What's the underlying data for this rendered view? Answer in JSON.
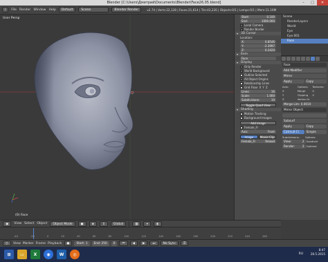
{
  "window": {
    "title": "Blender  [C:\\Users\\Дмитрий\\Documents\\Blender\\Face26.05.blend]",
    "minimize": "–",
    "maximize": "□",
    "close": "✕"
  },
  "info_header": {
    "menus": [
      "File",
      "Render",
      "Window",
      "Help"
    ],
    "layout": "Default",
    "scene": "Scene",
    "engine": "Blender Render",
    "stats": "v2.74 | Verts:22,128 | Faces:21,614 | Tris:43,226 | Objects:0/1 | Lamps:0/1 | Mem:11.16M"
  },
  "viewport": {
    "view_label": "User Persp",
    "object_label": "(0) Face"
  },
  "n_panel": {
    "clip": {
      "header": "Clip",
      "start_label": "Start:",
      "start_value": "0.100",
      "end_label": "End:",
      "end_value": "1000.000",
      "local_camera": "Local Camera",
      "render_border": "Render Border"
    },
    "cursor": {
      "header": "3D Cursor",
      "location": "Location:",
      "x_label": "X:",
      "x": "0.8546",
      "y_label": "Y:",
      "y": "-2.3997",
      "z_label": "Z:",
      "z": "0.2420"
    },
    "item": {
      "header": "Item",
      "name": "Face"
    },
    "display": {
      "header": "Display",
      "only_render": "Only Render",
      "world_background": "World Background",
      "outline_selected": "Outline Selected",
      "all_object_origins": "All Object Origins",
      "relationship_lines": "Relationship Lines",
      "grid_floor": "Grid Floor",
      "x": "X",
      "y": "Y",
      "z": "Z",
      "lines_label": "Lines:",
      "lines": "16",
      "scale_label": "Scale:",
      "scale": "1.000",
      "subdiv_label": "Subdivisions:",
      "subdiv": "10",
      "toggle_quad": "Toggle Quad View"
    },
    "shading": {
      "header": "Shading",
      "motion_tracking": "Motion Tracking",
      "background_images": "Background Images",
      "add_image": "Add Image",
      "image_name": "Female_Fr",
      "axis_label": "Axis:",
      "axis": "Front",
      "image_btn": "Image",
      "movie_btn": "Movie Clip",
      "reload": "Reload"
    }
  },
  "outliner": {
    "items": [
      "Scene",
      "RenderLayers",
      "World",
      "Eye",
      "Eye.001",
      "Face"
    ],
    "selected_index": 5
  },
  "properties": {
    "object_name": "Face",
    "add_modifier": "Add Modifier",
    "mirror": {
      "name": "Mirror",
      "apply": "Apply",
      "copy": "Copy",
      "axis_label": "Axis:",
      "options_label": "Options:",
      "texture_label": "Textures:",
      "x": "X",
      "y": "Y",
      "z": "Z",
      "merge": "Merge",
      "clipping": "Clipping",
      "vertex_groups": "Vertex Gr",
      "u": "U",
      "v": "V",
      "merge_limit": "Merge Lim: 0.0010",
      "mirror_object": "Mirror Object:"
    },
    "subsurf": {
      "name": "Subsurf",
      "apply": "Apply",
      "copy": "Copy",
      "catmull": "Catmull-Cl",
      "simple": "Simple",
      "subdiv_label": "Subdivisions:",
      "options_label": "Options:",
      "view_label": "View:",
      "view": "2",
      "render_label": "Render:",
      "render": "2",
      "subdiv_uvs": "Subdivid",
      "optimal": "Optimal"
    }
  },
  "view3d_header": {
    "menus": [
      "View",
      "Select",
      "Object"
    ],
    "mode": "Object Mode",
    "pivot": "Global"
  },
  "timeline": {
    "ticks": [
      "-40",
      "-20",
      "0",
      "20",
      "40",
      "60",
      "80",
      "100",
      "120",
      "140",
      "160",
      "180",
      "200",
      "220",
      "240",
      "260"
    ],
    "menus": [
      "View",
      "Marker",
      "Frame",
      "Playback"
    ],
    "start_label": "Start:",
    "start": "1",
    "end_label": "End:",
    "end": "250",
    "current": "0",
    "sync": "No Sync"
  },
  "taskbar": {
    "language": "RU",
    "time": "8:47",
    "date": "28.5.2015"
  },
  "colors": {
    "accent": "#5680c2",
    "panel": "#4a4a4a",
    "viewport": "#3a3a3a",
    "taskbar": "#1f2b4a"
  }
}
